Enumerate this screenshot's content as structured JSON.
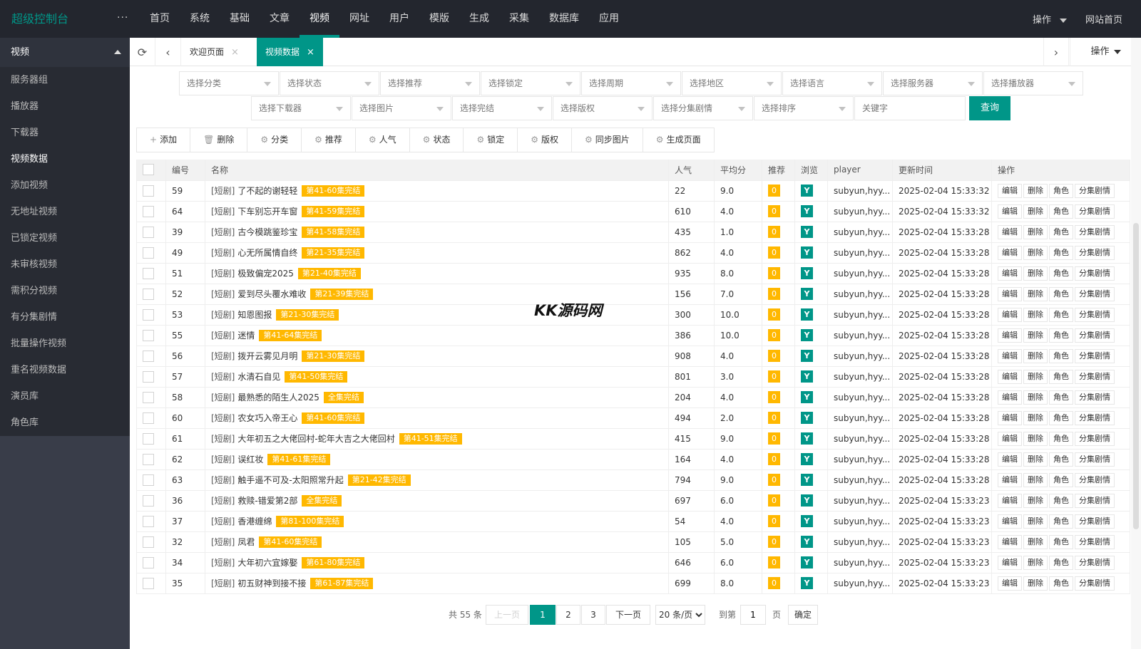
{
  "app": {
    "logo": "超级控制台",
    "more": "···"
  },
  "topnav": [
    "首页",
    "系统",
    "基础",
    "文章",
    "视频",
    "网址",
    "用户",
    "模版",
    "生成",
    "采集",
    "数据库",
    "应用"
  ],
  "topright": {
    "ops": "操作",
    "home": "网站首页"
  },
  "sidebar": {
    "group": "视频",
    "items": [
      "服务器组",
      "播放器",
      "下载器",
      "视频数据",
      "添加视频",
      "无地址视频",
      "已锁定视频",
      "未审核视频",
      "需积分视频",
      "有分集剧情",
      "批量操作视频",
      "重名视频数据",
      "演员库",
      "角色库"
    ]
  },
  "tabs": {
    "welcome": "欢迎页面",
    "current": "视频数据",
    "close": "×",
    "ops": "操作"
  },
  "filters": {
    "row1": [
      "选择分类",
      "选择状态",
      "选择推荐",
      "选择锁定",
      "选择周期",
      "选择地区",
      "选择语言",
      "选择服务器",
      "选择播放器"
    ],
    "row2": [
      "选择下载器",
      "选择图片",
      "选择完结",
      "选择版权",
      "选择分集剧情",
      "选择排序"
    ],
    "keyword_placeholder": "关键字",
    "query": "查询"
  },
  "toolbar": [
    {
      "icon": "+",
      "label": "添加"
    },
    {
      "icon": "🗑",
      "label": "删除"
    },
    {
      "icon": "⚙",
      "label": "分类"
    },
    {
      "icon": "⚙",
      "label": "推荐"
    },
    {
      "icon": "⚙",
      "label": "人气"
    },
    {
      "icon": "⚙",
      "label": "状态"
    },
    {
      "icon": "⚙",
      "label": "锁定"
    },
    {
      "icon": "⚙",
      "label": "版权"
    },
    {
      "icon": "⚙",
      "label": "同步图片"
    },
    {
      "icon": "⚙",
      "label": "生成页面"
    }
  ],
  "table": {
    "headers": [
      "编号",
      "名称",
      "人气",
      "平均分",
      "推荐",
      "浏览",
      "player",
      "更新时间",
      "操作"
    ],
    "ops": [
      "编辑",
      "删除",
      "角色",
      "分集剧情"
    ],
    "rows": [
      {
        "id": "59",
        "type": "[短剧]",
        "name": "了不起的谢轻轻",
        "tag": "第41-60集完结",
        "hits": "22",
        "score": "9.0",
        "rec": "0",
        "view": "Y",
        "player": "subyun,hyy...",
        "time": "2025-02-04 15:33:32"
      },
      {
        "id": "64",
        "type": "[短剧]",
        "name": "下车别忘开车窗",
        "tag": "第41-59集完结",
        "hits": "610",
        "score": "4.0",
        "rec": "0",
        "view": "Y",
        "player": "subyun,hyy...",
        "time": "2025-02-04 15:33:32"
      },
      {
        "id": "39",
        "type": "[短剧]",
        "name": "古今模跳鉴珍宝",
        "tag": "第41-58集完结",
        "hits": "435",
        "score": "1.0",
        "rec": "0",
        "view": "Y",
        "player": "subyun,hyy...",
        "time": "2025-02-04 15:33:28"
      },
      {
        "id": "49",
        "type": "[短剧]",
        "name": "心无所属情自终",
        "tag": "第21-35集完结",
        "hits": "862",
        "score": "4.0",
        "rec": "0",
        "view": "Y",
        "player": "subyun,hyy...",
        "time": "2025-02-04 15:33:28"
      },
      {
        "id": "51",
        "type": "[短剧]",
        "name": "极致偏宠2025",
        "tag": "第21-40集完结",
        "hits": "935",
        "score": "8.0",
        "rec": "0",
        "view": "Y",
        "player": "subyun,hyy...",
        "time": "2025-02-04 15:33:28"
      },
      {
        "id": "52",
        "type": "[短剧]",
        "name": "爱到尽头覆水难收",
        "tag": "第21-39集完结",
        "hits": "156",
        "score": "7.0",
        "rec": "0",
        "view": "Y",
        "player": "subyun,hyy...",
        "time": "2025-02-04 15:33:28"
      },
      {
        "id": "53",
        "type": "[短剧]",
        "name": "知恩图报",
        "tag": "第21-30集完结",
        "hits": "300",
        "score": "10.0",
        "rec": "0",
        "view": "Y",
        "player": "subyun,hyy...",
        "time": "2025-02-04 15:33:28"
      },
      {
        "id": "55",
        "type": "[短剧]",
        "name": "迷情",
        "tag": "第41-64集完结",
        "hits": "386",
        "score": "10.0",
        "rec": "0",
        "view": "Y",
        "player": "subyun,hyy...",
        "time": "2025-02-04 15:33:28"
      },
      {
        "id": "56",
        "type": "[短剧]",
        "name": "拨开云雾见月明",
        "tag": "第21-30集完结",
        "hits": "908",
        "score": "4.0",
        "rec": "0",
        "view": "Y",
        "player": "subyun,hyy...",
        "time": "2025-02-04 15:33:28"
      },
      {
        "id": "57",
        "type": "[短剧]",
        "name": "水清石自见",
        "tag": "第41-50集完结",
        "hits": "801",
        "score": "3.0",
        "rec": "0",
        "view": "Y",
        "player": "subyun,hyy...",
        "time": "2025-02-04 15:33:28"
      },
      {
        "id": "58",
        "type": "[短剧]",
        "name": "最熟悉的陌生人2025",
        "tag": "全集完结",
        "hits": "204",
        "score": "4.0",
        "rec": "0",
        "view": "Y",
        "player": "subyun,hyy...",
        "time": "2025-02-04 15:33:28"
      },
      {
        "id": "60",
        "type": "[短剧]",
        "name": "农女巧入帝王心",
        "tag": "第41-60集完结",
        "hits": "494",
        "score": "2.0",
        "rec": "0",
        "view": "Y",
        "player": "subyun,hyy...",
        "time": "2025-02-04 15:33:28"
      },
      {
        "id": "61",
        "type": "[短剧]",
        "name": "大年初五之大佬回村-蛇年大吉之大佬回村",
        "tag": "第41-51集完结",
        "hits": "415",
        "score": "9.0",
        "rec": "0",
        "view": "Y",
        "player": "subyun,hyy...",
        "time": "2025-02-04 15:33:28"
      },
      {
        "id": "62",
        "type": "[短剧]",
        "name": "误红妆",
        "tag": "第41-61集完结",
        "hits": "164",
        "score": "4.0",
        "rec": "0",
        "view": "Y",
        "player": "subyun,hyy...",
        "time": "2025-02-04 15:33:28"
      },
      {
        "id": "63",
        "type": "[短剧]",
        "name": "触手遥不可及-太阳照常升起",
        "tag": "第21-42集完结",
        "hits": "794",
        "score": "9.0",
        "rec": "0",
        "view": "Y",
        "player": "subyun,hyy...",
        "time": "2025-02-04 15:33:28"
      },
      {
        "id": "36",
        "type": "[短剧]",
        "name": "救赎-错爱第2部",
        "tag": "全集完结",
        "hits": "697",
        "score": "6.0",
        "rec": "0",
        "view": "Y",
        "player": "subyun,hyy...",
        "time": "2025-02-04 15:33:23"
      },
      {
        "id": "37",
        "type": "[短剧]",
        "name": "香港缠绵",
        "tag": "第81-100集完结",
        "hits": "54",
        "score": "4.0",
        "rec": "0",
        "view": "Y",
        "player": "subyun,hyy...",
        "time": "2025-02-04 15:33:23"
      },
      {
        "id": "32",
        "type": "[短剧]",
        "name": "凤君",
        "tag": "第41-60集完结",
        "hits": "105",
        "score": "5.0",
        "rec": "0",
        "view": "Y",
        "player": "subyun,hyy...",
        "time": "2025-02-04 15:33:23"
      },
      {
        "id": "34",
        "type": "[短剧]",
        "name": "大年初六宜嫁娶",
        "tag": "第61-80集完结",
        "hits": "646",
        "score": "6.0",
        "rec": "0",
        "view": "Y",
        "player": "subyun,hyy...",
        "time": "2025-02-04 15:33:23"
      },
      {
        "id": "35",
        "type": "[短剧]",
        "name": "初五财神到接不接",
        "tag": "第61-87集完结",
        "hits": "699",
        "score": "8.0",
        "rec": "0",
        "view": "Y",
        "player": "subyun,hyy...",
        "time": "2025-02-04 15:33:23"
      }
    ]
  },
  "watermark": "KK源码网",
  "pagination": {
    "total": "共 55 条",
    "prev": "上一页",
    "pages": [
      "1",
      "2",
      "3"
    ],
    "next": "下一页",
    "limit": "20 条/页",
    "goto": "到第",
    "page_value": "1",
    "page_unit": "页",
    "confirm": "确定"
  },
  "colors": {
    "accent": "#009688",
    "warn": "#ffb800",
    "topbar": "#23262e",
    "sidebar": "#393d49"
  }
}
